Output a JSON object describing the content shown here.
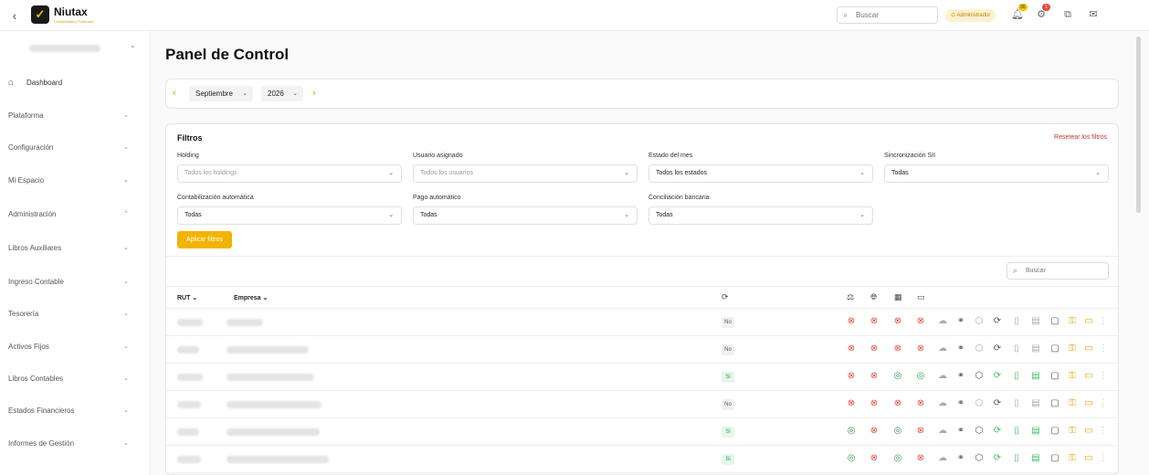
{
  "header": {
    "back_icon": "chevron-left",
    "logo_glyph": "✓",
    "brand_name": "Niutax",
    "brand_tagline": "Contabilidad y Finanzas",
    "search_placeholder": "Buscar",
    "admin_label": "Administrador",
    "notifications_count": "30",
    "alerts_count": "1"
  },
  "sidebar": {
    "items": [
      {
        "label": "Dashboard",
        "expanded": null
      },
      {
        "label": "Plataforma",
        "expanded": false
      },
      {
        "label": "Configuración",
        "expanded": false
      },
      {
        "label": "Mi Espacio",
        "expanded": false
      },
      {
        "label": "Administración",
        "expanded": true
      },
      {
        "label": "Libros Auxiliares",
        "expanded": false
      },
      {
        "label": "Ingreso Contable",
        "expanded": false
      },
      {
        "label": "Tesorería",
        "expanded": false
      },
      {
        "label": "Activos Fijos",
        "expanded": false
      },
      {
        "label": "Libros Contables",
        "expanded": false
      },
      {
        "label": "Estados Financieros",
        "expanded": false
      },
      {
        "label": "Informes de Gestión",
        "expanded": false
      }
    ]
  },
  "main": {
    "title": "Panel de Control",
    "period": {
      "month": "Septiembre",
      "year": "2026"
    }
  },
  "filters": {
    "title": "Filtros",
    "reset_label": "Resetear los filtros",
    "holding": {
      "label": "Holding",
      "placeholder": "Todos los holdings"
    },
    "usuario": {
      "label": "Usuario asignado",
      "placeholder": "Todos los usuarios"
    },
    "estado": {
      "label": "Estado del mes",
      "value": "Todos los estados"
    },
    "sii": {
      "label": "Sincronización SII",
      "value": "Todas"
    },
    "contab": {
      "label": "Contabilización automática",
      "value": "Todas"
    },
    "pago": {
      "label": "Pago automático",
      "value": "Todas"
    },
    "concil": {
      "label": "Conciliación bancaria",
      "value": "Todas"
    },
    "apply_label": "Aplicar filtros"
  },
  "table": {
    "search_placeholder": "Buscar",
    "col_rut": "RUT",
    "col_empresa": "Empresa",
    "rows": [
      {
        "sync": "No",
        "checks": [
          "bad",
          "bad",
          "bad",
          "bad"
        ],
        "active": false
      },
      {
        "sync": "No",
        "checks": [
          "bad",
          "bad",
          "bad",
          "bad"
        ],
        "active": false
      },
      {
        "sync": "Si",
        "checks": [
          "bad",
          "bad",
          "good",
          "good"
        ],
        "active": true
      },
      {
        "sync": "No",
        "checks": [
          "bad",
          "bad",
          "bad",
          "bad"
        ],
        "active": false
      },
      {
        "sync": "Si",
        "checks": [
          "good",
          "bad",
          "good",
          "bad"
        ],
        "active": true
      },
      {
        "sync": "Si",
        "checks": [
          "good",
          "bad",
          "good",
          "bad"
        ],
        "active": true
      }
    ]
  },
  "colors": {
    "accent": "#f2b400",
    "danger": "#e74c3c",
    "success": "#2e9a4b"
  }
}
